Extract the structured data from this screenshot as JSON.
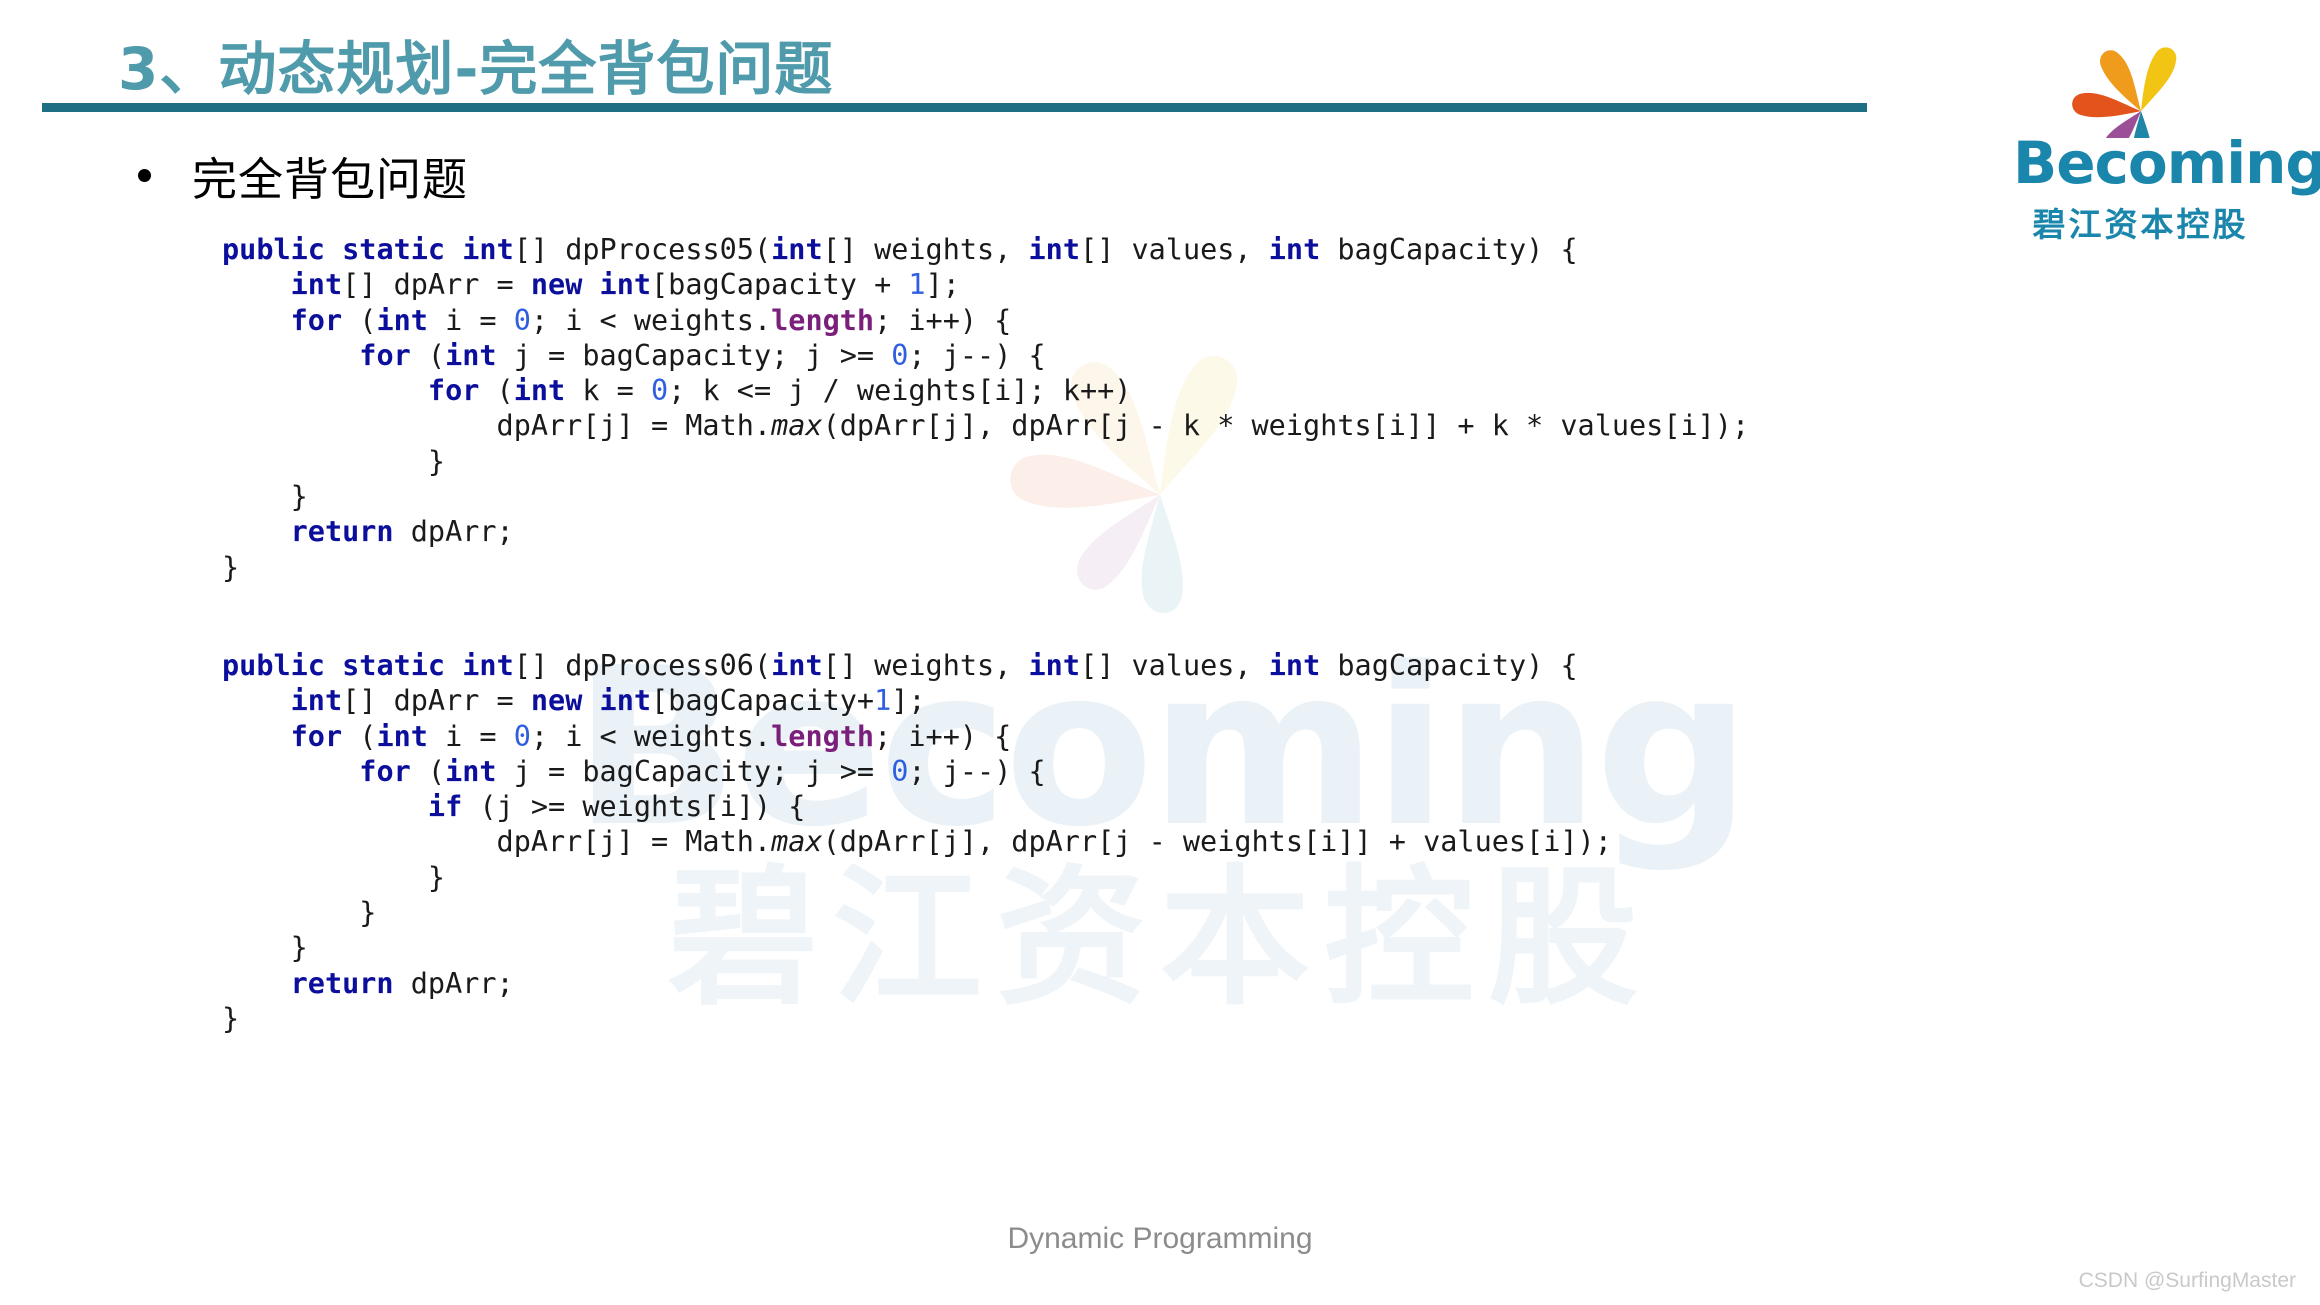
{
  "title": {
    "text": "3、动态规划-完全背包问题",
    "color": "#4f9aab",
    "rule_color": "#1f6f84"
  },
  "logo": {
    "word": "Becoming",
    "chinese": "碧江资本控股",
    "brand_color": "#1a86ab",
    "petal_colors": [
      "#f2c414",
      "#ef9b1b",
      "#e2541c",
      "#9a4f96",
      "#1f86a8"
    ]
  },
  "bullet": {
    "icon": "bullet-dot",
    "text": "完全背包问题"
  },
  "code_blocks": [
    {
      "id": "code-1",
      "method_name": "dpProcess05",
      "lines": [
        [
          {
            "t": "public",
            "c": "k"
          },
          {
            "t": " ",
            "c": "p"
          },
          {
            "t": "static",
            "c": "k"
          },
          {
            "t": " ",
            "c": "p"
          },
          {
            "t": "int",
            "c": "k"
          },
          {
            "t": "[] dpProcess05(",
            "c": "p"
          },
          {
            "t": "int",
            "c": "k"
          },
          {
            "t": "[] weights, ",
            "c": "p"
          },
          {
            "t": "int",
            "c": "k"
          },
          {
            "t": "[] values, ",
            "c": "p"
          },
          {
            "t": "int",
            "c": "k"
          },
          {
            "t": " bagCapacity) {",
            "c": "p"
          }
        ],
        [
          {
            "t": "    ",
            "c": "p"
          },
          {
            "t": "int",
            "c": "k"
          },
          {
            "t": "[] dpArr = ",
            "c": "p"
          },
          {
            "t": "new",
            "c": "k"
          },
          {
            "t": " ",
            "c": "p"
          },
          {
            "t": "int",
            "c": "k"
          },
          {
            "t": "[bagCapacity + ",
            "c": "p"
          },
          {
            "t": "1",
            "c": "n"
          },
          {
            "t": "];",
            "c": "p"
          }
        ],
        [
          {
            "t": "    ",
            "c": "p"
          },
          {
            "t": "for",
            "c": "k"
          },
          {
            "t": " (",
            "c": "p"
          },
          {
            "t": "int",
            "c": "k"
          },
          {
            "t": " i = ",
            "c": "p"
          },
          {
            "t": "0",
            "c": "n"
          },
          {
            "t": "; i < weights.",
            "c": "p"
          },
          {
            "t": "length",
            "c": "f"
          },
          {
            "t": "; i++) {",
            "c": "p"
          }
        ],
        [
          {
            "t": "        ",
            "c": "p"
          },
          {
            "t": "for",
            "c": "k"
          },
          {
            "t": " (",
            "c": "p"
          },
          {
            "t": "int",
            "c": "k"
          },
          {
            "t": " j = bagCapacity; j >= ",
            "c": "p"
          },
          {
            "t": "0",
            "c": "n"
          },
          {
            "t": "; j--) {",
            "c": "p"
          }
        ],
        [
          {
            "t": "            ",
            "c": "p"
          },
          {
            "t": "for",
            "c": "k"
          },
          {
            "t": " (",
            "c": "p"
          },
          {
            "t": "int",
            "c": "k"
          },
          {
            "t": " k = ",
            "c": "p"
          },
          {
            "t": "0",
            "c": "n"
          },
          {
            "t": "; k <= j / weights[i]; k++)",
            "c": "p"
          }
        ],
        [
          {
            "t": "                dpArr[j] = Math.",
            "c": "p"
          },
          {
            "t": "max",
            "c": "m"
          },
          {
            "t": "(dpArr[j], dpArr[j - k * weights[i]] + k * values[i]);",
            "c": "p"
          }
        ],
        [
          {
            "t": "            }",
            "c": "p"
          }
        ],
        [
          {
            "t": "    }",
            "c": "p"
          }
        ],
        [
          {
            "t": "    ",
            "c": "p"
          },
          {
            "t": "return",
            "c": "k"
          },
          {
            "t": " dpArr;",
            "c": "p"
          }
        ],
        [
          {
            "t": "}",
            "c": "p"
          }
        ]
      ]
    },
    {
      "id": "code-2",
      "method_name": "dpProcess06",
      "lines": [
        [
          {
            "t": "public",
            "c": "k"
          },
          {
            "t": " ",
            "c": "p"
          },
          {
            "t": "static",
            "c": "k"
          },
          {
            "t": " ",
            "c": "p"
          },
          {
            "t": "int",
            "c": "k"
          },
          {
            "t": "[] dpProcess06(",
            "c": "p"
          },
          {
            "t": "int",
            "c": "k"
          },
          {
            "t": "[] weights, ",
            "c": "p"
          },
          {
            "t": "int",
            "c": "k"
          },
          {
            "t": "[] values, ",
            "c": "p"
          },
          {
            "t": "int",
            "c": "k"
          },
          {
            "t": " bagCapacity) {",
            "c": "p"
          }
        ],
        [
          {
            "t": "    ",
            "c": "p"
          },
          {
            "t": "int",
            "c": "k"
          },
          {
            "t": "[] dpArr = ",
            "c": "p"
          },
          {
            "t": "new",
            "c": "k"
          },
          {
            "t": " ",
            "c": "p"
          },
          {
            "t": "int",
            "c": "k"
          },
          {
            "t": "[bagCapacity+",
            "c": "p"
          },
          {
            "t": "1",
            "c": "n"
          },
          {
            "t": "];",
            "c": "p"
          }
        ],
        [
          {
            "t": "    ",
            "c": "p"
          },
          {
            "t": "for",
            "c": "k"
          },
          {
            "t": " (",
            "c": "p"
          },
          {
            "t": "int",
            "c": "k"
          },
          {
            "t": " i = ",
            "c": "p"
          },
          {
            "t": "0",
            "c": "n"
          },
          {
            "t": "; i < weights.",
            "c": "p"
          },
          {
            "t": "length",
            "c": "f"
          },
          {
            "t": "; i++) {",
            "c": "p"
          }
        ],
        [
          {
            "t": "        ",
            "c": "p"
          },
          {
            "t": "for",
            "c": "k"
          },
          {
            "t": " (",
            "c": "p"
          },
          {
            "t": "int",
            "c": "k"
          },
          {
            "t": " j = bagCapacity; j >= ",
            "c": "p"
          },
          {
            "t": "0",
            "c": "n"
          },
          {
            "t": "; j--) {",
            "c": "p"
          }
        ],
        [
          {
            "t": "            ",
            "c": "p"
          },
          {
            "t": "if",
            "c": "k"
          },
          {
            "t": " (j >= weights[i]) {",
            "c": "p"
          }
        ],
        [
          {
            "t": "                dpArr[j] = Math.",
            "c": "p"
          },
          {
            "t": "max",
            "c": "m"
          },
          {
            "t": "(dpArr[j], dpArr[j - weights[i]] + values[i]);",
            "c": "p"
          }
        ],
        [
          {
            "t": "            }",
            "c": "p"
          }
        ],
        [
          {
            "t": "        }",
            "c": "p"
          }
        ],
        [
          {
            "t": "    }",
            "c": "p"
          }
        ],
        [
          {
            "t": "    ",
            "c": "p"
          },
          {
            "t": "return",
            "c": "k"
          },
          {
            "t": " dpArr;",
            "c": "p"
          }
        ],
        [
          {
            "t": "}",
            "c": "p"
          }
        ]
      ]
    }
  ],
  "footer": {
    "caption": "Dynamic Programming",
    "watermark": "CSDN @SurfingMaster"
  },
  "background_watermark": {
    "word": "Becoming",
    "chinese": "碧江资本控股"
  }
}
